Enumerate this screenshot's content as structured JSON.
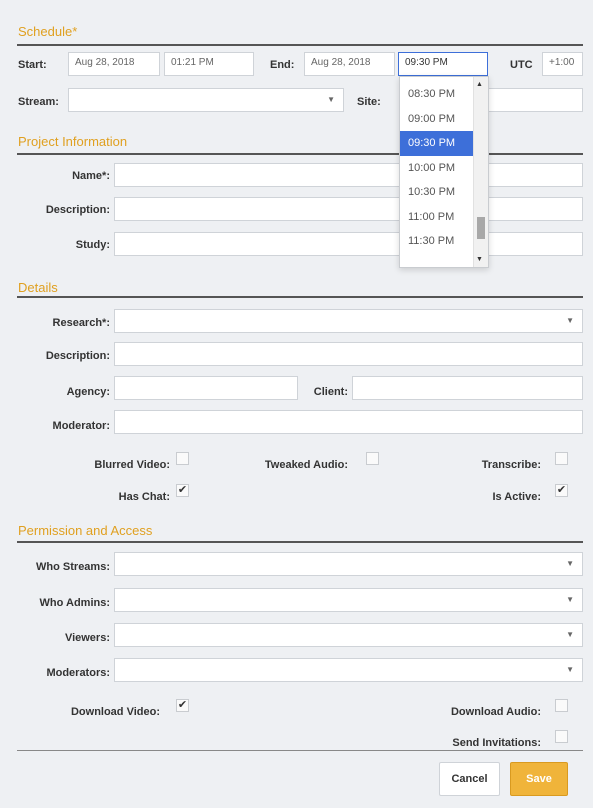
{
  "schedule": {
    "title": "Schedule*",
    "start_label": "Start:",
    "start_date": "Aug 28, 2018",
    "start_time": "01:21 PM",
    "end_label": "End:",
    "end_date": "Aug 28, 2018",
    "end_time": "09:30 PM",
    "utc_label": "UTC",
    "utc_value": "+1:00",
    "stream_label": "Stream:",
    "site_label": "Site:",
    "time_options": [
      "08:30 PM",
      "09:00 PM",
      "09:30 PM",
      "10:00 PM",
      "10:30 PM",
      "11:00 PM",
      "11:30 PM"
    ],
    "selected_time": "09:30 PM"
  },
  "project": {
    "title": "Project Information",
    "name_label": "Name*:",
    "description_label": "Description:",
    "study_label": "Study:"
  },
  "details": {
    "title": "Details",
    "research_label": "Research*:",
    "description_label": "Description:",
    "agency_label": "Agency:",
    "client_label": "Client:",
    "moderator_label": "Moderator:",
    "blurred_video_label": "Blurred Video:",
    "tweaked_audio_label": "Tweaked Audio:",
    "transcribe_label": "Transcribe:",
    "has_chat_label": "Has Chat:",
    "is_active_label": "Is Active:",
    "blurred_video": false,
    "tweaked_audio": false,
    "transcribe": false,
    "has_chat": true,
    "is_active": true
  },
  "permission": {
    "title": "Permission and Access",
    "who_streams_label": "Who Streams:",
    "who_admins_label": "Who Admins:",
    "viewers_label": "Viewers:",
    "moderators_label": "Moderators:",
    "download_video_label": "Download Video:",
    "download_audio_label": "Download Audio:",
    "send_invitations_label": "Send Invitations:",
    "download_video": true,
    "download_audio": false,
    "send_invitations": false
  },
  "actions": {
    "cancel_label": "Cancel",
    "save_label": "Save"
  },
  "colors": {
    "accent": "#e0a020",
    "save_button": "#f0b43a",
    "selected_option": "#3d6fd9"
  }
}
